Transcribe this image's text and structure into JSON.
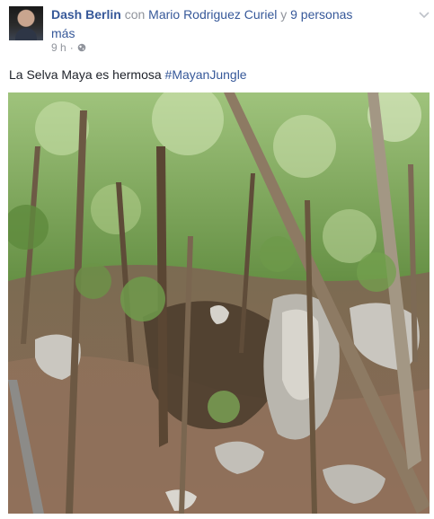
{
  "post": {
    "author": "Dash Berlin",
    "with_word": "con",
    "tagged_person": "Mario Rodriguez Curiel",
    "and_word": "y",
    "others_link": "9 personas",
    "others_suffix": "más",
    "timestamp": "9 h",
    "separator": "·",
    "privacy_icon": "globe-icon",
    "menu_icon": "chevron-down-icon",
    "text": "La Selva Maya es hermosa",
    "hashtag": "#MayanJungle",
    "image_subject": "jungle-photo",
    "colors": {
      "link": "#365899",
      "meta": "#90949c",
      "text": "#1d2129"
    }
  }
}
